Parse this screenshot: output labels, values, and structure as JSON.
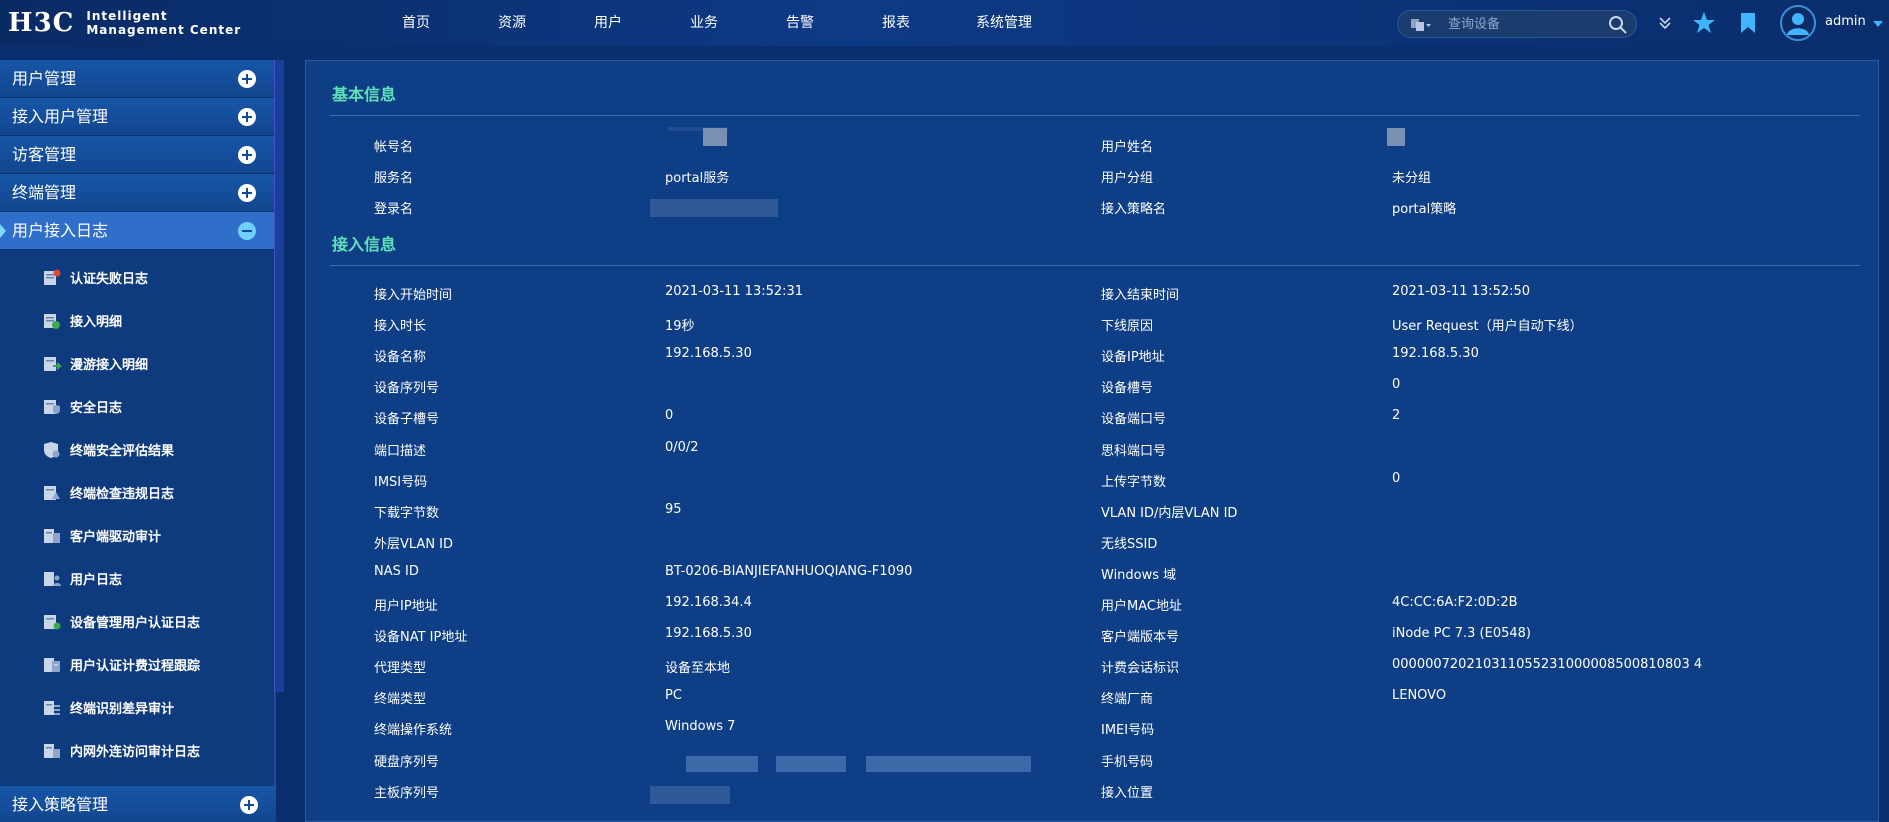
{
  "header": {
    "logo_mark": "H3C",
    "logo_line1": "Intelligent",
    "logo_line2": "Management Center",
    "nav": [
      "首页",
      "资源",
      "用户",
      "业务",
      "告警",
      "报表",
      "系统管理"
    ],
    "search_placeholder": "查询设备",
    "user": "admin"
  },
  "sidebar": {
    "groups": [
      "用户管理",
      "接入用户管理",
      "访客管理",
      "终端管理",
      "用户接入日志"
    ],
    "active_group": "用户接入日志",
    "sub_items": [
      "认证失败日志",
      "接入明细",
      "漫游接入明细",
      "安全日志",
      "终端安全评估结果",
      "终端检查违规日志",
      "客户端驱动审计",
      "用户日志",
      "设备管理用户认证日志",
      "用户认证计费过程跟踪",
      "终端识别差异审计",
      "内网外连访问审计日志"
    ],
    "bottom_group": "接入策略管理"
  },
  "basic": {
    "title": "基本信息",
    "rows": [
      {
        "l1": "帐号名",
        "v1": "",
        "l2": "用户姓名",
        "v2": ""
      },
      {
        "l1": "服务名",
        "v1": "portal服务",
        "l2": "用户分组",
        "v2": "未分组"
      },
      {
        "l1": "登录名",
        "v1": "",
        "l2": "接入策略名",
        "v2": "portal策略"
      }
    ]
  },
  "access": {
    "title": "接入信息",
    "rows": [
      {
        "l1": "接入开始时间",
        "v1": "2021-03-11 13:52:31",
        "l2": "接入结束时间",
        "v2": "2021-03-11 13:52:50"
      },
      {
        "l1": "接入时长",
        "v1": "19秒",
        "l2": "下线原因",
        "v2": "User Request（用户自动下线）"
      },
      {
        "l1": "设备名称",
        "v1": "192.168.5.30",
        "l2": "设备IP地址",
        "v2": "192.168.5.30"
      },
      {
        "l1": "设备序列号",
        "v1": "",
        "l2": "设备槽号",
        "v2": "0"
      },
      {
        "l1": "设备子槽号",
        "v1": "0",
        "l2": "设备端口号",
        "v2": "2"
      },
      {
        "l1": "端口描述",
        "v1": "0/0/2",
        "l2": "思科端口号",
        "v2": ""
      },
      {
        "l1": "IMSI号码",
        "v1": "",
        "l2": "上传字节数",
        "v2": "0"
      },
      {
        "l1": "下载字节数",
        "v1": "95",
        "l2": "VLAN ID/内层VLAN ID",
        "v2": ""
      },
      {
        "l1": "外层VLAN ID",
        "v1": "",
        "l2": "无线SSID",
        "v2": ""
      },
      {
        "l1": "NAS ID",
        "v1": "BT-0206-BIANJIEFANHUOQIANG-F1090",
        "l2": "Windows 域",
        "v2": ""
      },
      {
        "l1": "用户IP地址",
        "v1": "192.168.34.4",
        "l2": "用户MAC地址",
        "v2": "4C:CC:6A:F2:0D:2B"
      },
      {
        "l1": "设备NAT IP地址",
        "v1": "192.168.5.30",
        "l2": "客户端版本号",
        "v2": "iNode PC 7.3 (E0548)"
      },
      {
        "l1": "代理类型",
        "v1": "设备至本地",
        "l2": "计费会话标识",
        "v2": "000000720210311055231000008500810803 4"
      },
      {
        "l1": "终端类型",
        "v1": "PC",
        "l2": "终端厂商",
        "v2": "LENOVO"
      },
      {
        "l1": "终端操作系统",
        "v1": "Windows 7",
        "l2": "IMEI号码",
        "v2": ""
      },
      {
        "l1": "硬盘序列号",
        "v1": "",
        "l2": "手机号码",
        "v2": ""
      },
      {
        "l1": "主板序列号",
        "v1": "",
        "l2": "接入位置",
        "v2": ""
      }
    ]
  },
  "colors": {
    "accent": "#5fe0b8",
    "panel": "#0e3f86",
    "sidebar_active": "#2f6fc9"
  }
}
